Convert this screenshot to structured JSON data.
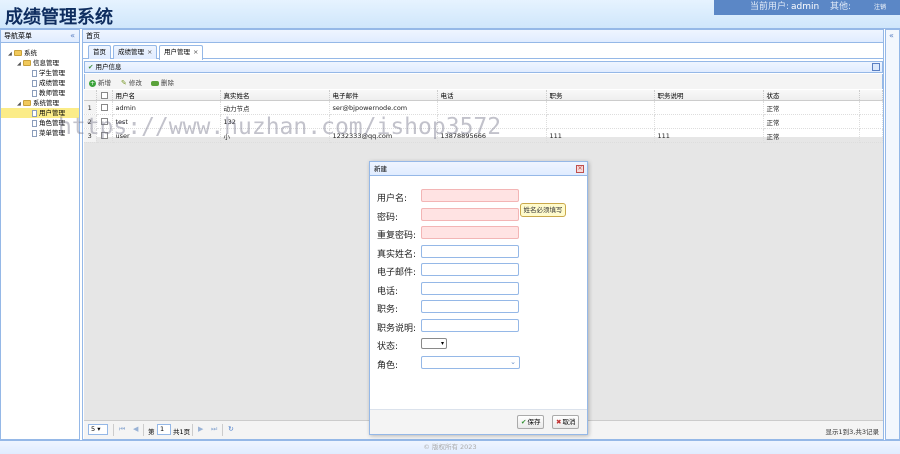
{
  "app": {
    "title": "成绩管理系统",
    "current_user_label": "当前用户:",
    "current_user": "admin",
    "other_label": "其他:",
    "logout": "注销"
  },
  "nav": {
    "title": "导航菜单",
    "tree": [
      {
        "label": "系统",
        "level": 0,
        "type": "folder",
        "toggle": "◢"
      },
      {
        "label": "信息管理",
        "level": 1,
        "type": "folder",
        "toggle": "◢"
      },
      {
        "label": "学生管理",
        "level": 2,
        "type": "file"
      },
      {
        "label": "成绩管理",
        "level": 2,
        "type": "file"
      },
      {
        "label": "教师管理",
        "level": 2,
        "type": "file"
      },
      {
        "label": "系统管理",
        "level": 1,
        "type": "folder",
        "toggle": "◢"
      },
      {
        "label": "用户管理",
        "level": 2,
        "type": "file",
        "selected": true
      },
      {
        "label": "角色管理",
        "level": 2,
        "type": "file"
      },
      {
        "label": "菜单管理",
        "level": 2,
        "type": "file"
      }
    ]
  },
  "center": {
    "title": "首页",
    "tabs": [
      {
        "label": "首页",
        "closable": false
      },
      {
        "label": "成绩管理",
        "closable": true
      },
      {
        "label": "用户管理",
        "closable": true,
        "active": true
      }
    ]
  },
  "grid": {
    "title": "用户信息",
    "toolbar": {
      "add": "新增",
      "edit": "修改",
      "delete": "删除"
    },
    "columns": [
      "用户名",
      "真实姓名",
      "电子邮件",
      "电话",
      "职务",
      "职务说明",
      "状态"
    ],
    "rows": [
      {
        "num": "1",
        "cells": [
          "admin",
          "动力节点",
          "ser@bjpowernode.com",
          "",
          "",
          "",
          "正常"
        ]
      },
      {
        "num": "2",
        "cells": [
          "test",
          "132",
          "",
          "",
          "",
          "",
          "正常"
        ]
      },
      {
        "num": "3",
        "cells": [
          "user",
          "小",
          "1232333@qq.com",
          "13878895666",
          "111",
          "111",
          "正常"
        ]
      }
    ],
    "pager": {
      "page_size": "5",
      "page_prefix": "第",
      "page": "1",
      "page_suffix": "共1页",
      "info": "显示1到3,共3记录"
    }
  },
  "watermark": "https://www.huzhan.com/ishop3572",
  "dialog": {
    "title": "新建",
    "fields": [
      {
        "label": "用户名:",
        "kind": "text",
        "invalid": true
      },
      {
        "label": "密码:",
        "kind": "text",
        "invalid": true
      },
      {
        "label": "重复密码:",
        "kind": "text",
        "invalid": true
      },
      {
        "label": "真实姓名:",
        "kind": "text"
      },
      {
        "label": "电子邮件:",
        "kind": "text"
      },
      {
        "label": "电话:",
        "kind": "text"
      },
      {
        "label": "职务:",
        "kind": "text"
      },
      {
        "label": "职务说明:",
        "kind": "text"
      },
      {
        "label": "状态:",
        "kind": "select"
      },
      {
        "label": "角色:",
        "kind": "combo"
      }
    ],
    "tooltip": "姓名必须填写",
    "save": "保存",
    "cancel": "取消"
  },
  "footer": "© 版权所有 2023"
}
